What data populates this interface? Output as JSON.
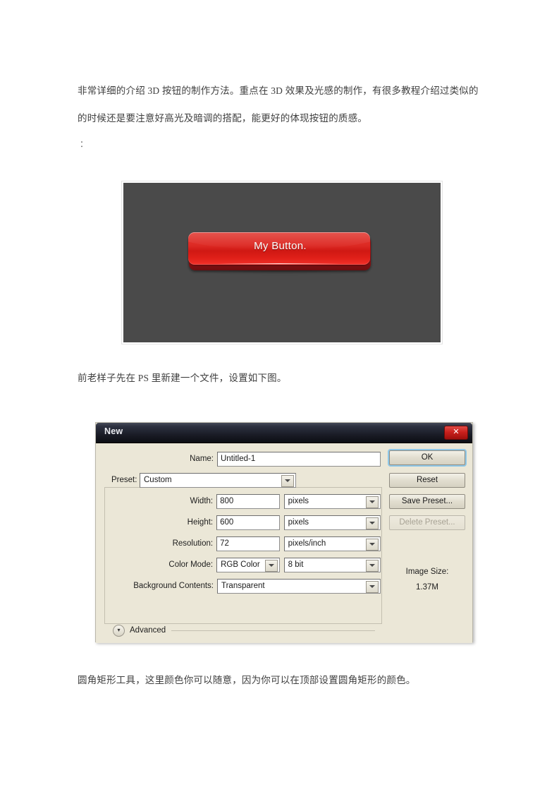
{
  "document": {
    "paragraphs": [
      "非常详细的介绍 3D 按钮的制作方法。重点在 3D 效果及光感的制作，有很多教程介绍过类似的",
      "的时候还是要注意好高光及暗调的搭配，能更好的体现按钮的质感。",
      "：",
      "前老样子先在 PS 里新建一个文件，设置如下图。",
      "圆角矩形工具，这里颜色你可以随意，因为你可以在顶部设置圆角矩形的颜色。"
    ]
  },
  "demo_image": {
    "button_label": "My Button.",
    "button_color": "#d01813",
    "canvas_color": "#4a4a4a"
  },
  "dialog": {
    "title": "New",
    "close_label": "✕",
    "fields": {
      "name_label": "Name:",
      "name_value": "Untitled-1",
      "preset_label": "Preset:",
      "preset_value": "Custom",
      "width_label": "Width:",
      "width_value": "800",
      "width_unit": "pixels",
      "height_label": "Height:",
      "height_value": "600",
      "height_unit": "pixels",
      "resolution_label": "Resolution:",
      "resolution_value": "72",
      "resolution_unit": "pixels/inch",
      "color_mode_label": "Color Mode:",
      "color_mode_value": "RGB Color",
      "bit_depth_value": "8 bit",
      "background_label": "Background Contents:",
      "background_value": "Transparent"
    },
    "advanced_label": "Advanced",
    "advanced_toggle_icon": "chevron-double-down-icon",
    "buttons": {
      "ok": "OK",
      "reset": "Reset",
      "save_preset": "Save Preset...",
      "delete_preset": "Delete Preset..."
    },
    "image_size": {
      "label": "Image Size:",
      "value": "1.37M"
    },
    "accent_color": "#8fc8e8",
    "titlebar_color": "#1a1c26"
  }
}
